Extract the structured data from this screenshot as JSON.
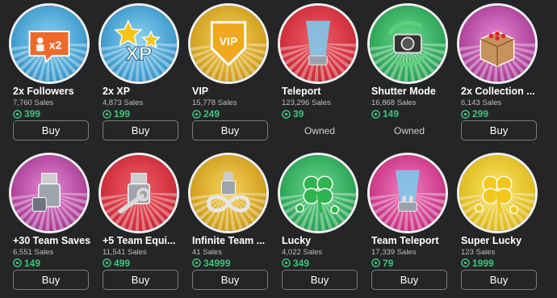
{
  "products": [
    {
      "name": "2x Followers",
      "sales": "7,760 Sales",
      "price": "399",
      "action": "Buy",
      "icon": "followers-x2-icon",
      "color": "#2d8fc6",
      "color_light": "#8fd3f0"
    },
    {
      "name": "2x XP",
      "sales": "4,873 Sales",
      "price": "199",
      "action": "Buy",
      "icon": "xp-stars-icon",
      "color": "#2d8fc6",
      "color_light": "#8fd3f0"
    },
    {
      "name": "VIP",
      "sales": "15,778 Sales",
      "price": "249",
      "action": "Buy",
      "icon": "vip-shield-icon",
      "color": "#c99512",
      "color_light": "#f7d35c"
    },
    {
      "name": "Teleport",
      "sales": "123,296 Sales",
      "price": "39",
      "action": "Owned",
      "icon": "teleport-beam-icon",
      "color": "#c72330",
      "color_light": "#f0606a"
    },
    {
      "name": "Shutter Mode",
      "sales": "16,868 Sales",
      "price": "149",
      "action": "Owned",
      "icon": "camera-icon",
      "color": "#1f9a4b",
      "color_light": "#6bd98f"
    },
    {
      "name": "2x Collection ...",
      "sales": "6,143 Sales",
      "price": "299",
      "action": "Buy",
      "icon": "box-icon",
      "color": "#a2338f",
      "color_light": "#e58ad4"
    },
    {
      "name": "+30 Team Saves",
      "sales": "6,551 Sales",
      "price": "149",
      "action": "Buy",
      "icon": "usb-save-icon",
      "color": "#a2338f",
      "color_light": "#e58ad4"
    },
    {
      "name": "+5 Team Equi...",
      "sales": "11,541 Sales",
      "price": "499",
      "action": "Buy",
      "icon": "usb-wrench-icon",
      "color": "#c72330",
      "color_light": "#f0606a"
    },
    {
      "name": "Infinite Team ...",
      "sales": "41 Sales",
      "price": "34999",
      "action": "Buy",
      "icon": "infinity-usb-icon",
      "color": "#c99512",
      "color_light": "#f7d35c"
    },
    {
      "name": "Lucky",
      "sales": "4,022 Sales",
      "price": "349",
      "action": "Buy",
      "icon": "clover-icon",
      "color": "#1f9a4b",
      "color_light": "#6bd98f"
    },
    {
      "name": "Team Teleport",
      "sales": "17,339 Sales",
      "price": "79",
      "action": "Buy",
      "icon": "team-teleport-icon",
      "color": "#c2287a",
      "color_light": "#f27fbf"
    },
    {
      "name": "Super Lucky",
      "sales": "123 Sales",
      "price": "1999",
      "action": "Buy",
      "icon": "gold-clover-icon",
      "color": "#d9b20f",
      "color_light": "#fbe76a"
    }
  ]
}
